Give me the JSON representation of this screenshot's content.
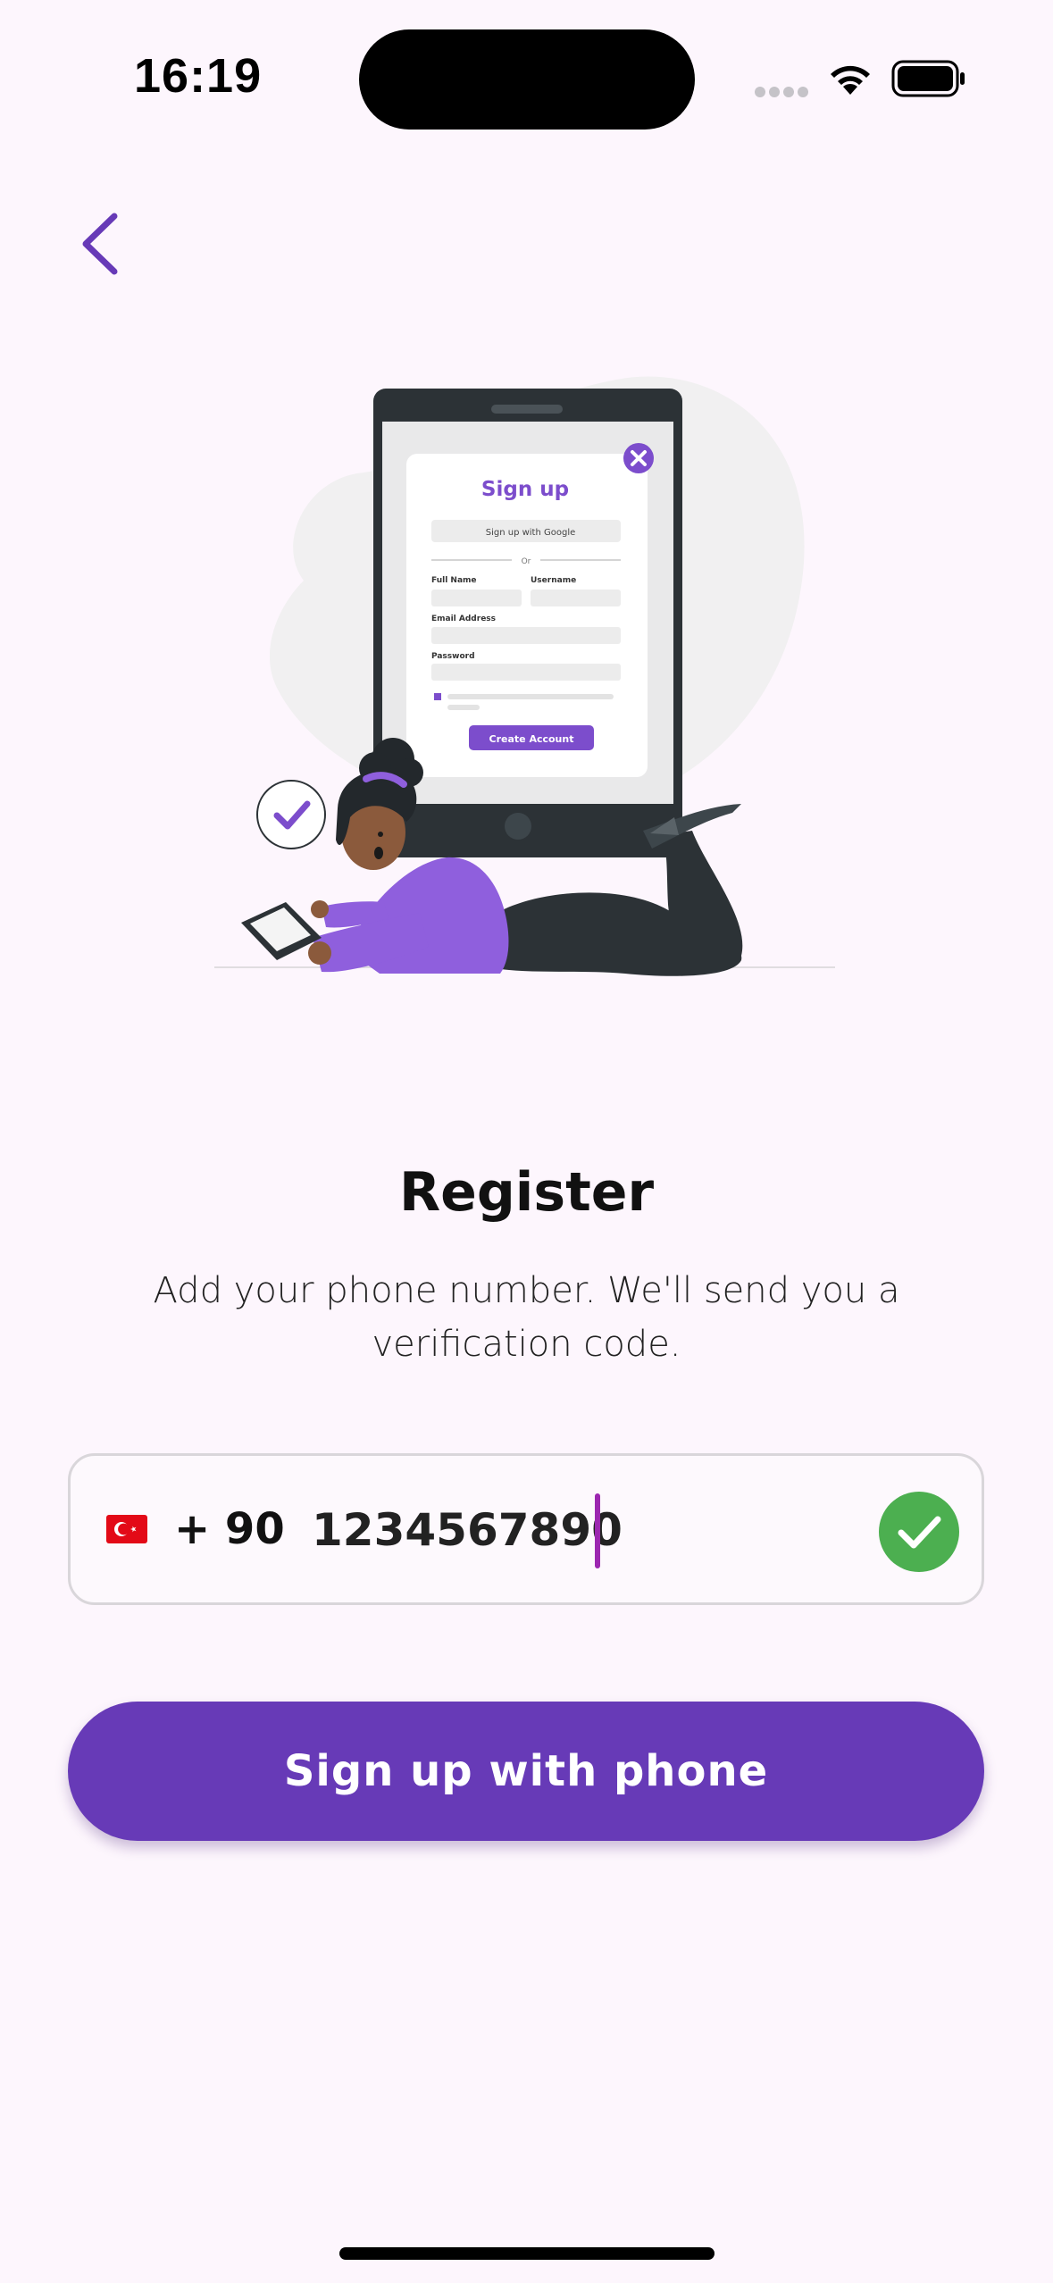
{
  "status_bar": {
    "time": "16:19"
  },
  "illustration": {
    "card_title": "Sign up",
    "google_button": "Sign up with Google",
    "divider_text": "Or",
    "label_full_name": "Full Name",
    "label_username": "Username",
    "label_email": "Email Address",
    "label_password": "Password",
    "create_button": "Create Account"
  },
  "page": {
    "title": "Register",
    "subtitle": "Add your phone number. We'll send you a verification code."
  },
  "phone_input": {
    "flag_country": "Turkey",
    "dial_code": "+ 90",
    "value": "1234567890"
  },
  "primary_button": {
    "label": "Sign up with phone"
  },
  "colors": {
    "accent": "#673ab7",
    "valid": "#4caf50",
    "background": "#fdf6fd",
    "caret": "#9c27b0"
  }
}
